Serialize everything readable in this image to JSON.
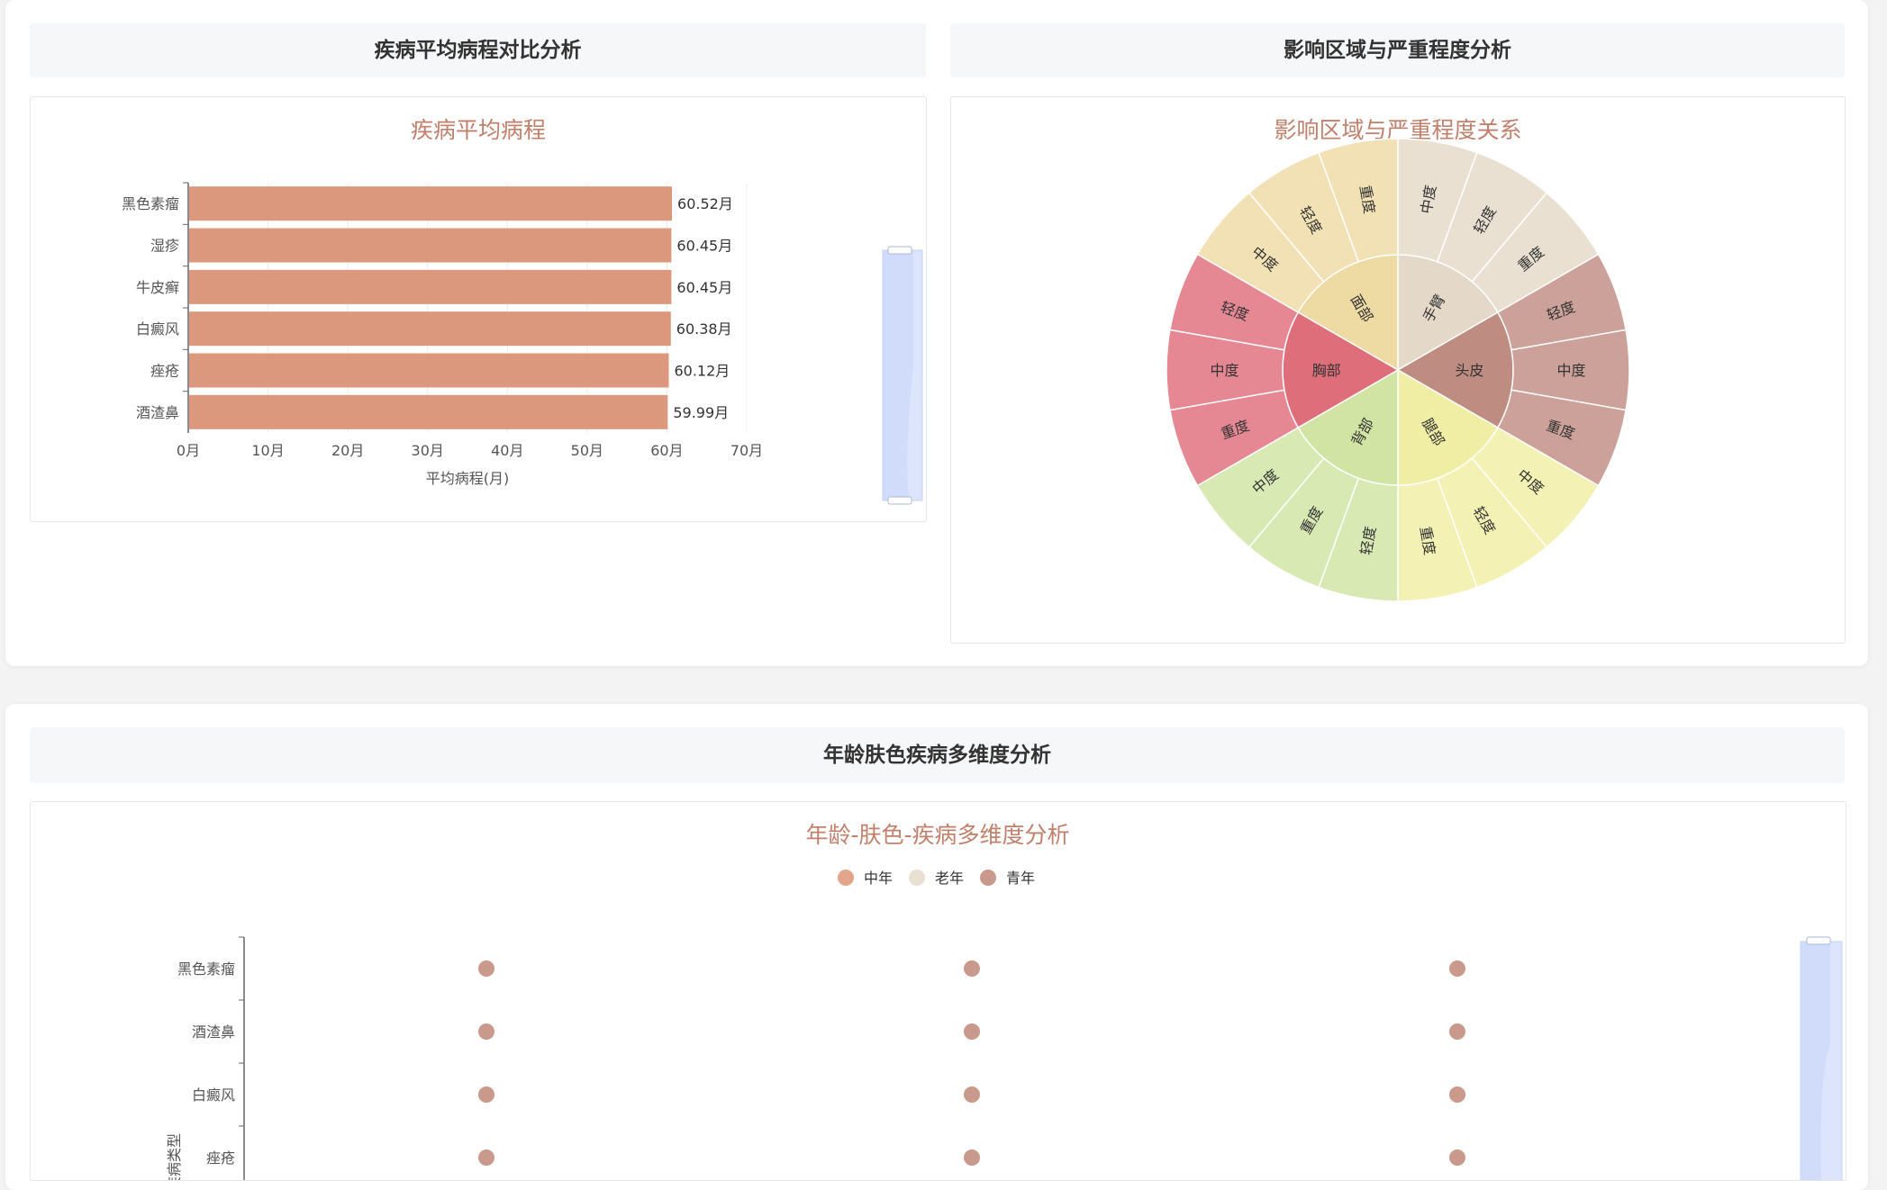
{
  "sections": {
    "top_left_header": "疾病平均病程对比分析",
    "top_right_header": "影响区域与严重程度分析",
    "bottom_header": "年龄肤色疾病多维度分析"
  },
  "chart_data": [
    {
      "type": "bar",
      "orientation": "horizontal",
      "title": "疾病平均病程",
      "categories": [
        "黑色素瘤",
        "湿疹",
        "牛皮癣",
        "白癜风",
        "痤疮",
        "酒渣鼻"
      ],
      "values": [
        60.52,
        60.45,
        60.45,
        60.38,
        60.12,
        59.99
      ],
      "value_labels": [
        "60.52月",
        "60.45月",
        "60.45月",
        "60.38月",
        "60.12月",
        "59.99月"
      ],
      "xlabel": "平均病程(月)",
      "xlim": [
        0,
        70
      ],
      "x_ticks": [
        0,
        10,
        20,
        30,
        40,
        50,
        60,
        70
      ],
      "x_tick_labels": [
        "0月",
        "10月",
        "20月",
        "30月",
        "40月",
        "50月",
        "60月",
        "70月"
      ],
      "bar_color": "#dc987c",
      "grid": true
    },
    {
      "type": "sunburst",
      "title": "影响区域与严重程度关系",
      "nodes": [
        {
          "name": "面部",
          "color": "#eedba4",
          "children": [
            {
              "name": "中度",
              "value": 1
            },
            {
              "name": "轻度",
              "value": 1
            },
            {
              "name": "重度",
              "value": 1
            }
          ]
        },
        {
          "name": "手臂",
          "color": "#e4d9c8",
          "children": [
            {
              "name": "中度",
              "value": 1
            },
            {
              "name": "轻度",
              "value": 1
            },
            {
              "name": "重度",
              "value": 1
            }
          ]
        },
        {
          "name": "头皮",
          "color": "#bf8c82",
          "children": [
            {
              "name": "轻度",
              "value": 1
            },
            {
              "name": "中度",
              "value": 1
            },
            {
              "name": "重度",
              "value": 1
            }
          ]
        },
        {
          "name": "腿部",
          "color": "#f0eea4",
          "children": [
            {
              "name": "中度",
              "value": 1
            },
            {
              "name": "轻度",
              "value": 1
            },
            {
              "name": "重度",
              "value": 1
            }
          ]
        },
        {
          "name": "背部",
          "color": "#d1e4a4",
          "children": [
            {
              "name": "轻度",
              "value": 1
            },
            {
              "name": "重度",
              "value": 1
            },
            {
              "name": "中度",
              "value": 1
            }
          ]
        },
        {
          "name": "胸部",
          "color": "#df6e7b",
          "children": [
            {
              "name": "重度",
              "value": 1
            },
            {
              "name": "中度",
              "value": 1
            },
            {
              "name": "轻度",
              "value": 1
            }
          ]
        }
      ]
    },
    {
      "type": "scatter",
      "title": "年龄-肤色-疾病多维度分析",
      "legend": [
        {
          "name": "中年",
          "color": "#e3a58b"
        },
        {
          "name": "老年",
          "color": "#e9e0d2"
        },
        {
          "name": "青年",
          "color": "#c99a8c"
        }
      ],
      "ylabel": "疾病类型",
      "y_categories": [
        "黑色素瘤",
        "酒渣鼻",
        "白癜风",
        "痤疮"
      ],
      "x_categories": [
        "",
        "",
        ""
      ],
      "point_color": "#c99a8c",
      "points": [
        {
          "x": 0,
          "y": "黑色素瘤"
        },
        {
          "x": 1,
          "y": "黑色素瘤"
        },
        {
          "x": 2,
          "y": "黑色素瘤"
        },
        {
          "x": 0,
          "y": "酒渣鼻"
        },
        {
          "x": 1,
          "y": "酒渣鼻"
        },
        {
          "x": 2,
          "y": "酒渣鼻"
        },
        {
          "x": 0,
          "y": "白癜风"
        },
        {
          "x": 1,
          "y": "白癜风"
        },
        {
          "x": 2,
          "y": "白癜风"
        },
        {
          "x": 0,
          "y": "痤疮"
        },
        {
          "x": 1,
          "y": "痤疮"
        },
        {
          "x": 2,
          "y": "痤疮"
        }
      ]
    }
  ]
}
